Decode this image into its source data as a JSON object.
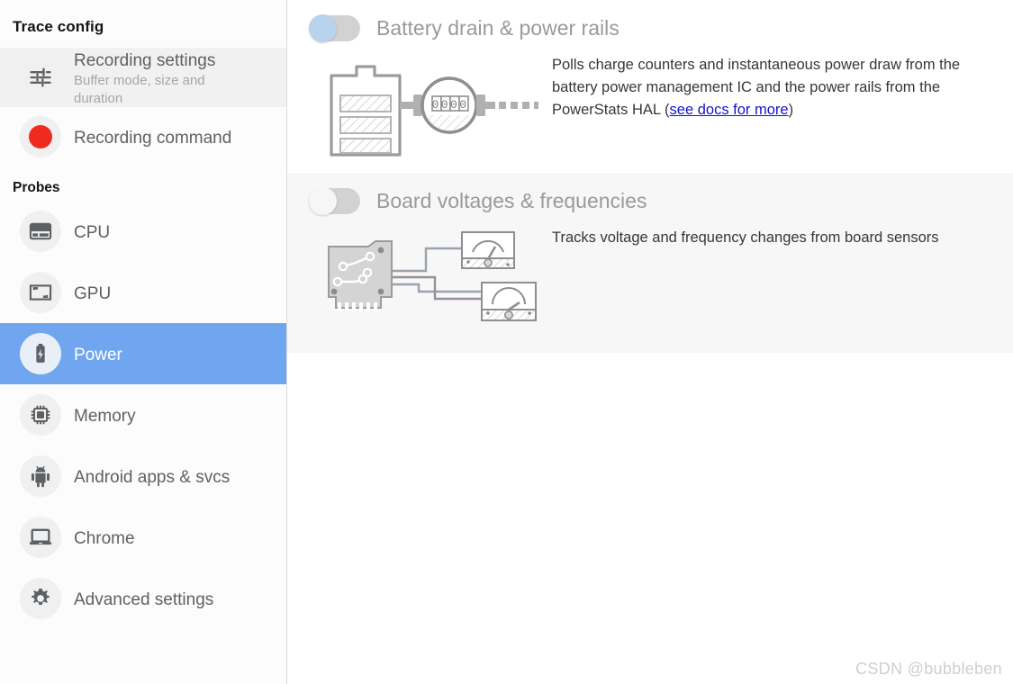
{
  "sidebar": {
    "title": "Trace config",
    "config_items": [
      {
        "label": "Recording settings",
        "sublabel": "Buffer mode, size and duration",
        "icon": "sliders-icon",
        "state": "hovered"
      },
      {
        "label": "Recording command",
        "sublabel": "",
        "icon": "record-dot-icon",
        "state": "normal"
      }
    ],
    "probes_label": "Probes",
    "probe_items": [
      {
        "label": "CPU",
        "icon": "cpu-icon",
        "state": "normal"
      },
      {
        "label": "GPU",
        "icon": "gpu-icon",
        "state": "normal"
      },
      {
        "label": "Power",
        "icon": "battery-bolt-icon",
        "state": "active"
      },
      {
        "label": "Memory",
        "icon": "memory-chip-icon",
        "state": "normal"
      },
      {
        "label": "Android apps & svcs",
        "icon": "android-icon",
        "state": "normal"
      },
      {
        "label": "Chrome",
        "icon": "laptop-icon",
        "state": "normal"
      },
      {
        "label": "Advanced settings",
        "icon": "gear-icon",
        "state": "normal"
      }
    ]
  },
  "main": {
    "sections": [
      {
        "title": "Battery drain & power rails",
        "toggle_state": "off",
        "toggle_style": "blue",
        "art": "battery-meter-illustration",
        "desc_before": "Polls charge counters and instantaneous power draw from the battery power management IC and the power rails from the PowerStats HAL (",
        "link_text": "see docs for more",
        "desc_after": ")"
      },
      {
        "title": "Board voltages & frequencies",
        "toggle_state": "off",
        "toggle_style": "grey",
        "art": "board-gauges-illustration",
        "desc_before": "Tracks voltage and frequency changes from board sensors",
        "link_text": "",
        "desc_after": ""
      }
    ]
  },
  "watermark": "CSDN @bubbleben",
  "colors": {
    "accent_blue": "#6fa6ef",
    "toggle_thumb_blue": "#b8d3ec",
    "toggle_track": "#d2d2d2",
    "record_red": "#ef2a1e",
    "link_blue": "#1414cc",
    "shaded_section": "#f7f7f8",
    "sidebar_bg": "#fcfcfc"
  }
}
